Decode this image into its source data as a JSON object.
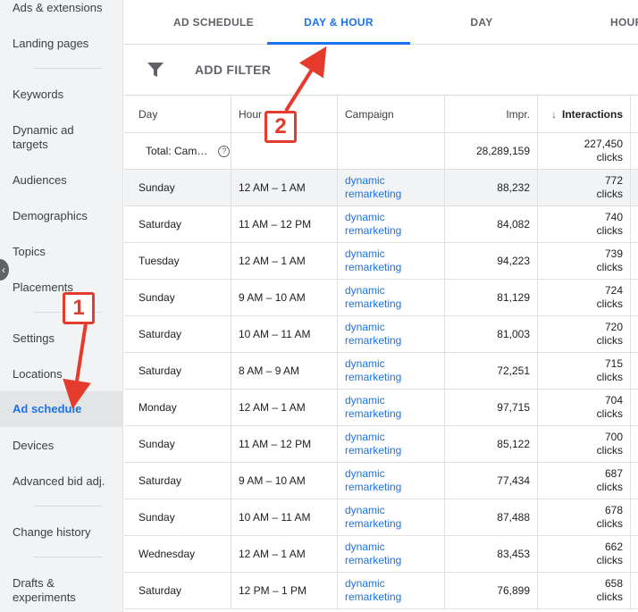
{
  "sidebar": {
    "items": [
      {
        "label": "Ads & extensions"
      },
      {
        "label": "Landing pages"
      },
      {
        "label": "Keywords"
      },
      {
        "label": "Dynamic ad targets"
      },
      {
        "label": "Audiences"
      },
      {
        "label": "Demographics"
      },
      {
        "label": "Topics"
      },
      {
        "label": "Placements"
      },
      {
        "label": "Settings"
      },
      {
        "label": "Locations"
      },
      {
        "label": "Ad schedule"
      },
      {
        "label": "Devices"
      },
      {
        "label": "Advanced bid adj."
      },
      {
        "label": "Change history"
      },
      {
        "label": "Drafts & experiments"
      }
    ],
    "active": "Ad schedule"
  },
  "tabs": [
    {
      "label": "AD SCHEDULE"
    },
    {
      "label": "DAY & HOUR"
    },
    {
      "label": "DAY"
    },
    {
      "label": "HOUR"
    }
  ],
  "filter": {
    "label": "ADD FILTER"
  },
  "table": {
    "headers": {
      "day": "Day",
      "hour": "Hour",
      "campaign": "Campaign",
      "impr": "Impr.",
      "interactions": "Interactions"
    },
    "total": {
      "label": "Total: Cam…",
      "impr": "28,289,159",
      "interactions": "227,450",
      "unit": "clicks"
    },
    "rows": [
      {
        "day": "Sunday",
        "hour": "12 AM – 1 AM",
        "campaign1": "dynamic",
        "campaign2": "remarketing",
        "impr": "88,232",
        "interactions": "772",
        "unit": "clicks"
      },
      {
        "day": "Saturday",
        "hour": "11 AM – 12 PM",
        "campaign1": "dynamic",
        "campaign2": "remarketing",
        "impr": "84,082",
        "interactions": "740",
        "unit": "clicks"
      },
      {
        "day": "Tuesday",
        "hour": "12 AM – 1 AM",
        "campaign1": "dynamic",
        "campaign2": "remarketing",
        "impr": "94,223",
        "interactions": "739",
        "unit": "clicks"
      },
      {
        "day": "Sunday",
        "hour": "9 AM – 10 AM",
        "campaign1": "dynamic",
        "campaign2": "remarketing",
        "impr": "81,129",
        "interactions": "724",
        "unit": "clicks"
      },
      {
        "day": "Saturday",
        "hour": "10 AM – 11 AM",
        "campaign1": "dynamic",
        "campaign2": "remarketing",
        "impr": "81,003",
        "interactions": "720",
        "unit": "clicks"
      },
      {
        "day": "Saturday",
        "hour": "8 AM – 9 AM",
        "campaign1": "dynamic",
        "campaign2": "remarketing",
        "impr": "72,251",
        "interactions": "715",
        "unit": "clicks"
      },
      {
        "day": "Monday",
        "hour": "12 AM – 1 AM",
        "campaign1": "dynamic",
        "campaign2": "remarketing",
        "impr": "97,715",
        "interactions": "704",
        "unit": "clicks"
      },
      {
        "day": "Sunday",
        "hour": "11 AM – 12 PM",
        "campaign1": "dynamic",
        "campaign2": "remarketing",
        "impr": "85,122",
        "interactions": "700",
        "unit": "clicks"
      },
      {
        "day": "Saturday",
        "hour": "9 AM – 10 AM",
        "campaign1": "dynamic",
        "campaign2": "remarketing",
        "impr": "77,434",
        "interactions": "687",
        "unit": "clicks"
      },
      {
        "day": "Sunday",
        "hour": "10 AM – 11 AM",
        "campaign1": "dynamic",
        "campaign2": "remarketing",
        "impr": "87,488",
        "interactions": "678",
        "unit": "clicks"
      },
      {
        "day": "Wednesday",
        "hour": "12 AM – 1 AM",
        "campaign1": "dynamic",
        "campaign2": "remarketing",
        "impr": "83,453",
        "interactions": "662",
        "unit": "clicks"
      },
      {
        "day": "Saturday",
        "hour": "12 PM – 1 PM",
        "campaign1": "dynamic",
        "campaign2": "remarketing",
        "impr": "76,899",
        "interactions": "658",
        "unit": "clicks"
      }
    ]
  },
  "annotations": {
    "callout1": "1",
    "callout2": "2",
    "color": "#e43b2c"
  },
  "colors": {
    "accent": "#1a73e8",
    "sidebar_bg": "#f1f3f4"
  }
}
